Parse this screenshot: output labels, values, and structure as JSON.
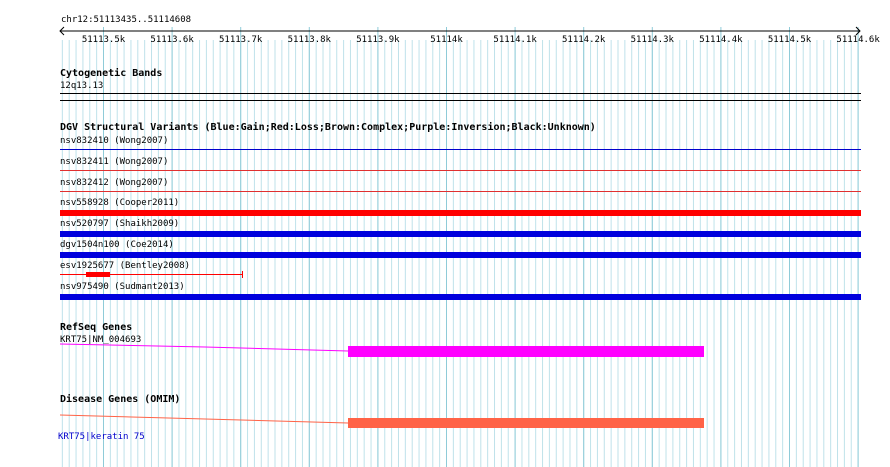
{
  "location": "chr12:51113435..51114608",
  "ruler_ticks": [
    "51113.5k",
    "51113.6k",
    "51113.7k",
    "51113.8k",
    "51113.9k",
    "51114k",
    "51114.1k",
    "51114.2k",
    "51114.3k",
    "51114.4k",
    "51114.5k",
    "51114.6k"
  ],
  "tracks": {
    "cytobands": {
      "title": "Cytogenetic Bands",
      "band": "12q13.13"
    },
    "dgv": {
      "title": "DGV Structural Variants (Blue:Gain;Red:Loss;Brown:Complex;Purple:Inversion;Black:Unknown)",
      "features": [
        {
          "label": "nsv832410 (Wong2007)",
          "color": "#0000cc"
        },
        {
          "label": "nsv832411 (Wong2007)",
          "color": "#e03030"
        },
        {
          "label": "nsv832412 (Wong2007)",
          "color": "#e03030"
        },
        {
          "label": "nsv558928 (Cooper2011)",
          "color": "#ff0000"
        },
        {
          "label": "nsv520797 (Shaikh2009)",
          "color": "#0000dd"
        },
        {
          "label": "dgv1504n100 (Coe2014)",
          "color": "#0000dd"
        },
        {
          "label": "esv1925677 (Bentley2008)",
          "color": "#ff0000"
        },
        {
          "label": "nsv975490 (Sudmant2013)",
          "color": "#0000dd"
        }
      ]
    },
    "refseq": {
      "title": "RefSeq Genes",
      "gene": "KRT75|NM_004693",
      "color": "#ff00ff"
    },
    "omim": {
      "title": "Disease Genes (OMIM)",
      "gene": "KRT75|keratin 75",
      "color": "#ff6347"
    }
  }
}
